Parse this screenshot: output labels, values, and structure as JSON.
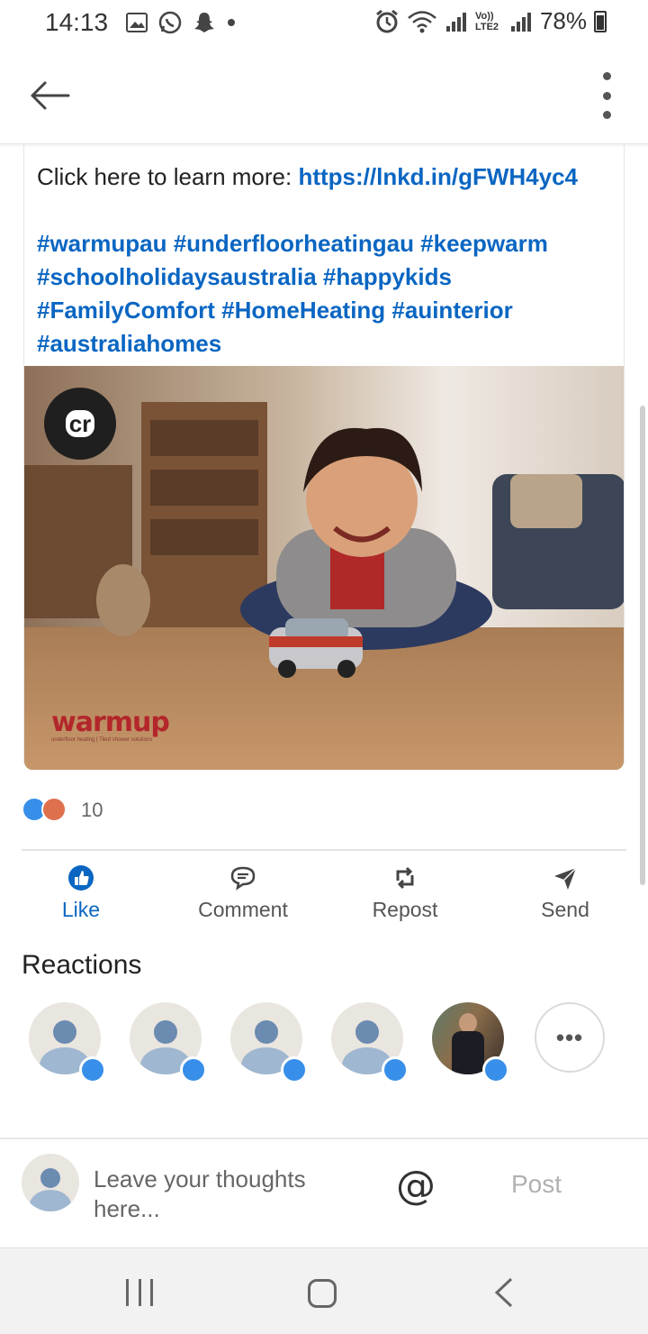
{
  "status_bar": {
    "time": "14:13",
    "carrier": "Vo)) LTE2",
    "battery": "78%"
  },
  "post": {
    "learn_more_prefix": "Click here to learn more: ",
    "link": "https://lnkd.in/gFWH4yc4",
    "hashtags_lines": [
      "#warmupau #underfloorheatingau #keepwarm",
      "#schoolholidaysaustralia #happykids",
      "#FamilyComfort #HomeHeating #auinterior",
      "#australiahomes"
    ],
    "image": {
      "badge_text": "cr",
      "brand_logo": "warmup",
      "brand_tagline": "underfloor heating | Tiled shower solutions"
    },
    "reaction_count": "10"
  },
  "actions": {
    "like": "Like",
    "comment": "Comment",
    "repost": "Repost",
    "send": "Send"
  },
  "reactions": {
    "title": "Reactions",
    "more": "•••"
  },
  "composer": {
    "placeholder_line1": "Leave your thoughts",
    "placeholder_line2": "here...",
    "at_symbol": "@",
    "post": "Post"
  },
  "colors": {
    "link_blue": "#0a66c2",
    "like_blue": "#378fe9"
  }
}
